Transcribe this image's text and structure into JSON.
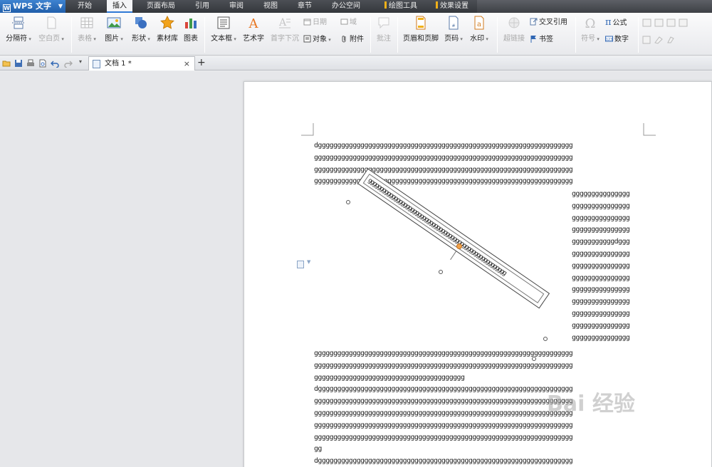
{
  "app": {
    "title": "WPS 文字"
  },
  "menu": {
    "tabs": [
      "开始",
      "插入",
      "页面布局",
      "引用",
      "审阅",
      "视图",
      "章节",
      "办公空间"
    ],
    "active_tab": "插入",
    "context_tabs": [
      "绘图工具",
      "效果设置"
    ]
  },
  "ribbon": {
    "page_break": "分隔符",
    "blank_page": "空白页",
    "table": "表格",
    "picture": "图片",
    "shape": "形状",
    "clipart": "素材库",
    "chart": "图表",
    "textbox": "文本框",
    "wordart": "艺术字",
    "dropcap": "首字下沉",
    "date": "日期",
    "field": "域",
    "object": "对象",
    "attachment": "附件",
    "comment": "批注",
    "header_footer": "页眉和页脚",
    "page_number": "页码",
    "watermark": "水印",
    "hyperlink": "超链接",
    "cross_ref": "交叉引用",
    "bookmark": "书签",
    "symbol": "符号",
    "formula": "公式",
    "number": "数字"
  },
  "doc_tab": {
    "title": "文档 1 *",
    "close": "×",
    "new": "+"
  },
  "document": {
    "top_lines": [
      "dgggggggggggggggggggggggggggggggggggggggggggggggggggggggggggggggggg",
      "ggggggggggggggggggggggggggggggggggggggggggggggggggggggggggggggggggg",
      "ggggggggggggggggggggggggggggggggggggggggggggggggggggggggggggggggggg",
      "ggggggggggggggggggggggggggggggggggggggggggggggggggggggggggggggggggg"
    ],
    "wrap_lines": [
      "ggggggggggggggg",
      "ggggggggggggggg",
      "ggggggggggggggg",
      "ggggggggggggggg",
      "gggggggggggdggg",
      "ggggggggggggggg",
      "ggggggggggggggg",
      "ggggggggggggggg",
      "ggggggggggggggg",
      "ggggggggggggggg",
      "ggggggggggggggg",
      "ggggggggggggggg",
      "ggggggggggggggg"
    ],
    "bottom_lines": [
      "ggggggggggggggggggggggggggggggggggggggggggggggggggggggggggggggggggg",
      "ggggggggggggggggggggggggggggggggggggggggggggggggggggggggggggggggggg",
      "ggggggggggggggggggggggggggggggggggggggg",
      "dgggggggggggggggggggggggggggggggggggggggggggggggggggggggggggggggggg",
      "ggggggggggggggggggggggggggggggggggggggggggggggggggggggggggggggggggg",
      "ggggggggggggggggggggggggggggggggggggggggggggggggggggggggggggggggggg",
      "ggggggggggggggggggggggggggggggggggggggggggggggggggggggggggggggggggg",
      "ggggggggggggggggggggggggggggggggggggggggggggggggggggggggggggggggggg",
      "gg",
      "dgggggggggggggggggggggggggggggggggggggggggggggggggggggggggggggggggg"
    ],
    "textbox_text": "gggggggggggggggggggggggggggggggggggggggggggggggggggggggggg"
  },
  "watermark_text": "Bai 经验",
  "colors": {
    "accent": "#2f79d5",
    "ctx_marker": "#f0b019",
    "rotate_handle": "#f2a34a"
  }
}
